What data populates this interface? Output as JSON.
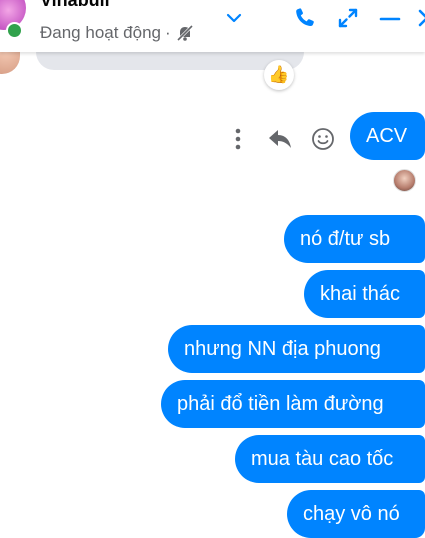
{
  "header": {
    "contact_name": "Vinabull",
    "status": "Đang hoạt động",
    "status_separator": "·",
    "icons": {
      "muted": "bell-off-icon",
      "menu": "chevron-down-icon",
      "call": "phone-icon",
      "expand": "expand-icon",
      "minimize": "minimize-icon",
      "close": "close-icon"
    }
  },
  "chat": {
    "reaction": "👍",
    "message_actions": [
      "more-icon",
      "reply-icon",
      "emoji-icon"
    ],
    "messages": [
      {
        "text": "ACV"
      },
      {
        "text": "nó đ/tư  sb"
      },
      {
        "text": "khai thác"
      },
      {
        "text": "nhưng NN địa phuong"
      },
      {
        "text": "phải đổ tiền làm đường"
      },
      {
        "text": "mua tàu cao tốc"
      },
      {
        "text": "chạy vô nó"
      }
    ]
  },
  "colors": {
    "accent": "#0084ff",
    "online": "#31a24c",
    "peer_bubble": "#e4e6eb",
    "secondary_text": "#65676b"
  }
}
